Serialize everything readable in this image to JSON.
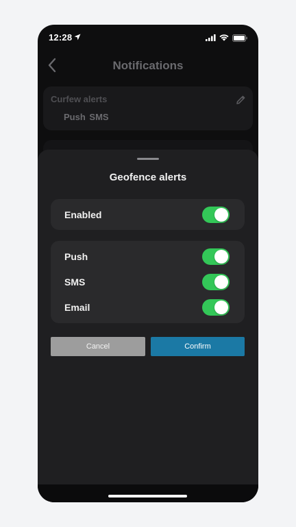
{
  "status_bar": {
    "time": "12:28",
    "icons": [
      "location-arrow-icon",
      "cellular-signal-icon",
      "wifi-icon",
      "battery-icon"
    ]
  },
  "header": {
    "title": "Notifications",
    "back_icon": "chevron-left-icon"
  },
  "background_card": {
    "title": "Curfew alerts",
    "channels": "Push  SMS",
    "edit_icon": "pencil-icon"
  },
  "sheet": {
    "title": "Geofence alerts",
    "enabled": {
      "label": "Enabled",
      "on": true
    },
    "channels": [
      {
        "label": "Push",
        "on": true
      },
      {
        "label": "SMS",
        "on": true
      },
      {
        "label": "Email",
        "on": true
      }
    ],
    "cancel_label": "Cancel",
    "confirm_label": "Confirm"
  },
  "colors": {
    "toggle_on": "#33c758",
    "confirm": "#1b79a5",
    "cancel": "#9d9d9d",
    "sheet_bg": "#1f1f21",
    "group_bg": "#2a2a2c"
  }
}
